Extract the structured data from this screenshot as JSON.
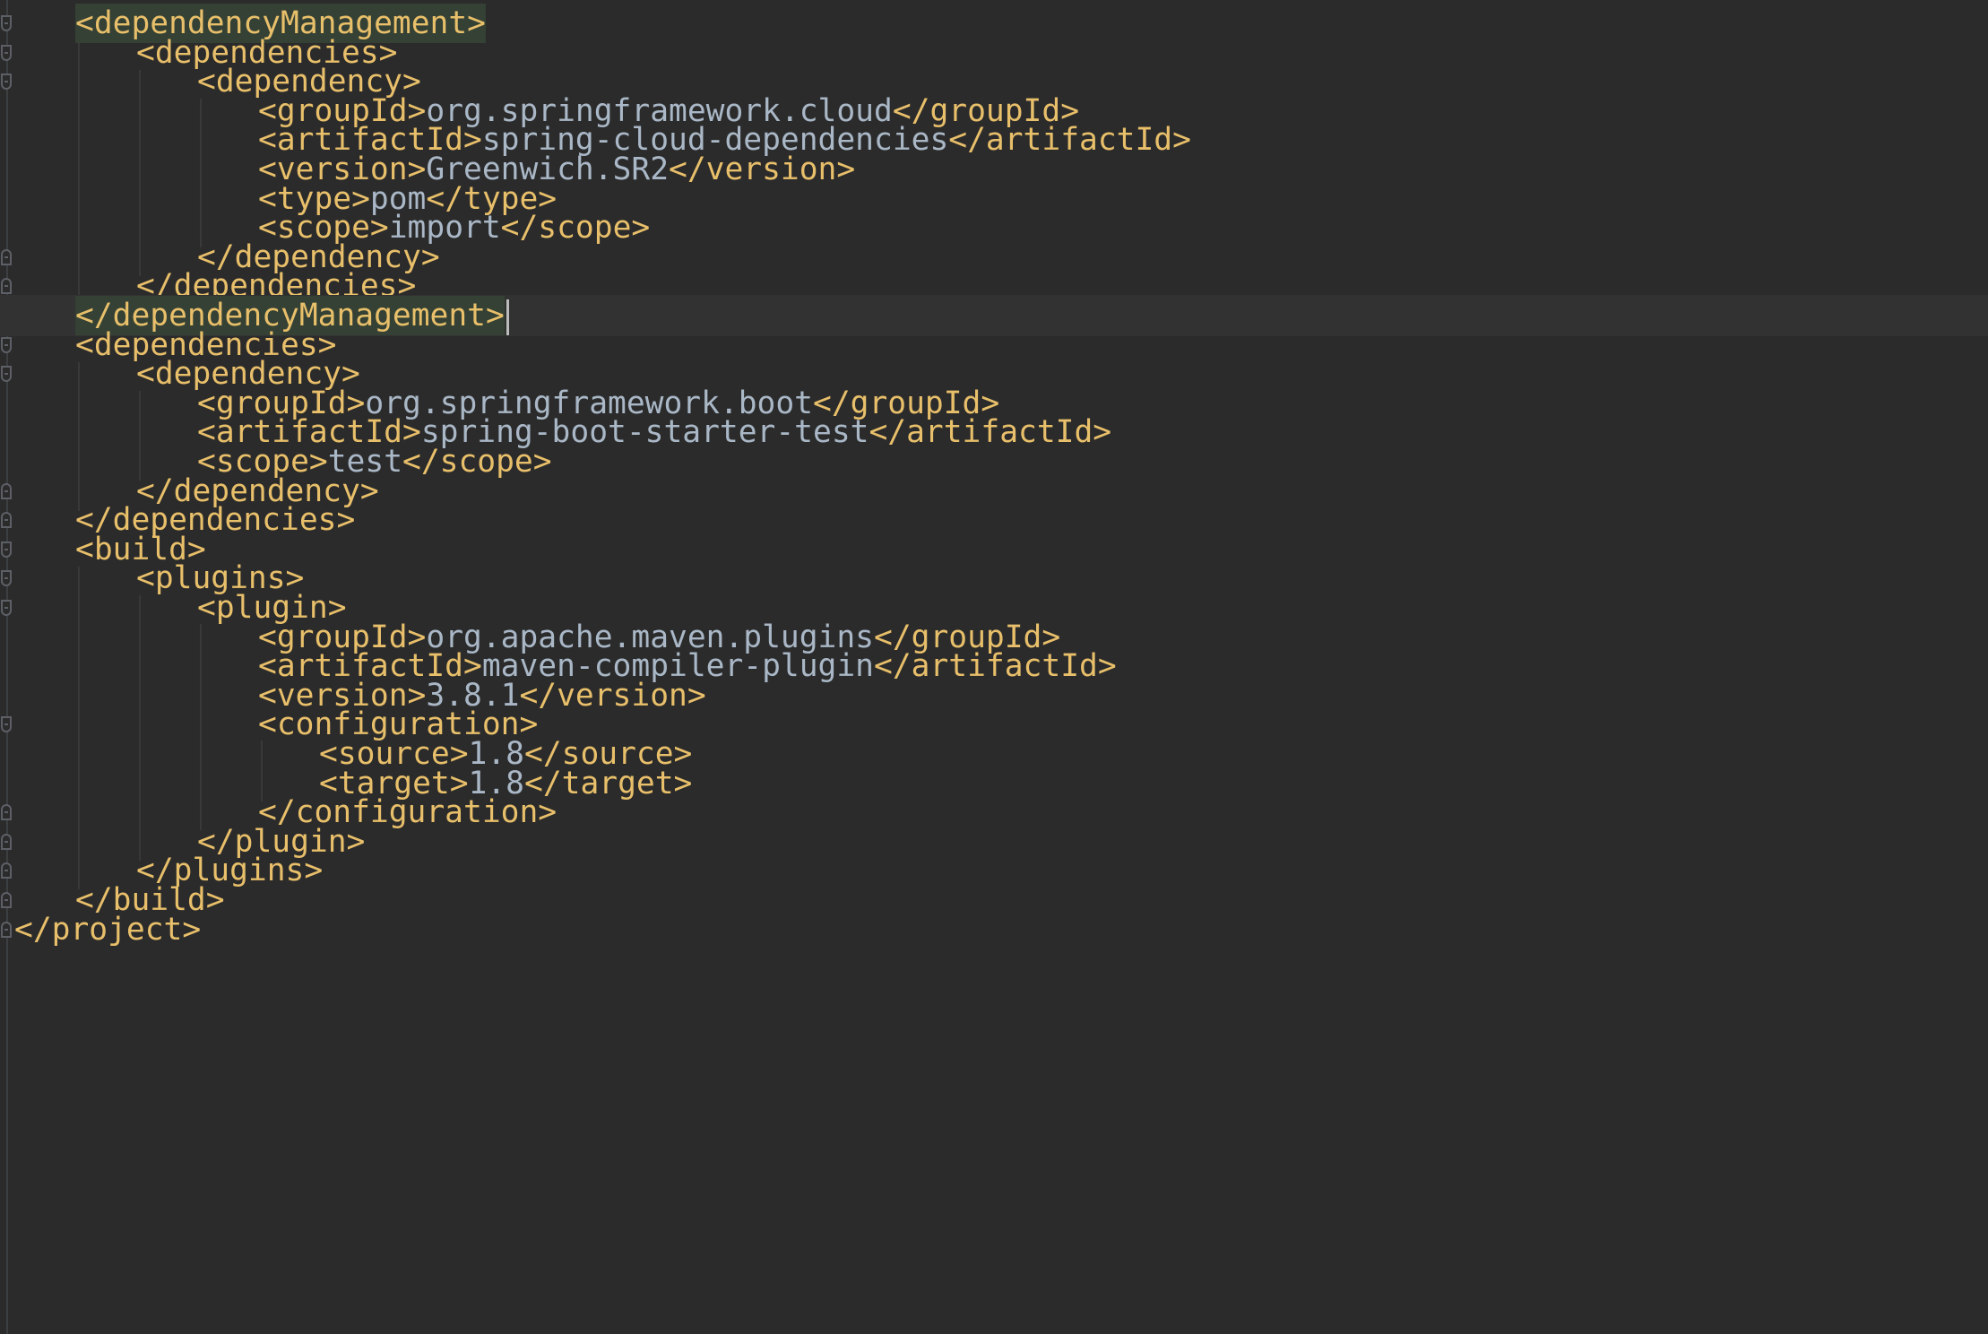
{
  "editor": {
    "language": "xml",
    "colors": {
      "background": "#2b2b2b",
      "tag": "#e8bf6a",
      "text": "#a9b7c6",
      "match_highlight": "#344134",
      "current_line": "#323232"
    },
    "lines": [
      {
        "open": "<dependencyManagement>",
        "value": "",
        "close": "",
        "highlight": true
      },
      {
        "open": "<dependencies>",
        "value": "",
        "close": ""
      },
      {
        "open": "<dependency>",
        "value": "",
        "close": ""
      },
      {
        "open": "<groupId>",
        "value": "org.springframework.cloud",
        "close": "</groupId>"
      },
      {
        "open": "<artifactId>",
        "value": "spring-cloud-dependencies",
        "close": "</artifactId>"
      },
      {
        "open": "<version>",
        "value": "Greenwich.SR2",
        "close": "</version>"
      },
      {
        "open": "<type>",
        "value": "pom",
        "close": "</type>"
      },
      {
        "open": "<scope>",
        "value": "import",
        "close": "</scope>"
      },
      {
        "open": "</dependency>",
        "value": "",
        "close": ""
      },
      {
        "open": "</dependencies>",
        "value": "",
        "close": ""
      },
      {
        "open": "</dependencyManagement>",
        "value": "",
        "close": "",
        "highlight": true,
        "current": true
      },
      {
        "open": "<dependencies>",
        "value": "",
        "close": ""
      },
      {
        "open": "<dependency>",
        "value": "",
        "close": ""
      },
      {
        "open": "<groupId>",
        "value": "org.springframework.boot",
        "close": "</groupId>"
      },
      {
        "open": "<artifactId>",
        "value": "spring-boot-starter-test",
        "close": "</artifactId>"
      },
      {
        "open": "<scope>",
        "value": "test",
        "close": "</scope>"
      },
      {
        "open": "</dependency>",
        "value": "",
        "close": ""
      },
      {
        "open": "</dependencies>",
        "value": "",
        "close": ""
      },
      {
        "open": "<build>",
        "value": "",
        "close": ""
      },
      {
        "open": "<plugins>",
        "value": "",
        "close": ""
      },
      {
        "open": "<plugin>",
        "value": "",
        "close": ""
      },
      {
        "open": "<groupId>",
        "value": "org.apache.maven.plugins",
        "close": "</groupId>"
      },
      {
        "open": "<artifactId>",
        "value": "maven-compiler-plugin",
        "close": "</artifactId>"
      },
      {
        "open": "<version>",
        "value": "3.8.1",
        "close": "</version>"
      },
      {
        "open": "<configuration>",
        "value": "",
        "close": ""
      },
      {
        "open": "<source>",
        "value": "1.8",
        "close": "</source>"
      },
      {
        "open": "<target>",
        "value": "1.8",
        "close": "</target>"
      },
      {
        "open": "</configuration>",
        "value": "",
        "close": ""
      },
      {
        "open": "</plugin>",
        "value": "",
        "close": ""
      },
      {
        "open": "</plugins>",
        "value": "",
        "close": ""
      },
      {
        "open": "</build>",
        "value": "",
        "close": ""
      },
      {
        "open": "</project>",
        "value": "",
        "close": ""
      }
    ]
  }
}
